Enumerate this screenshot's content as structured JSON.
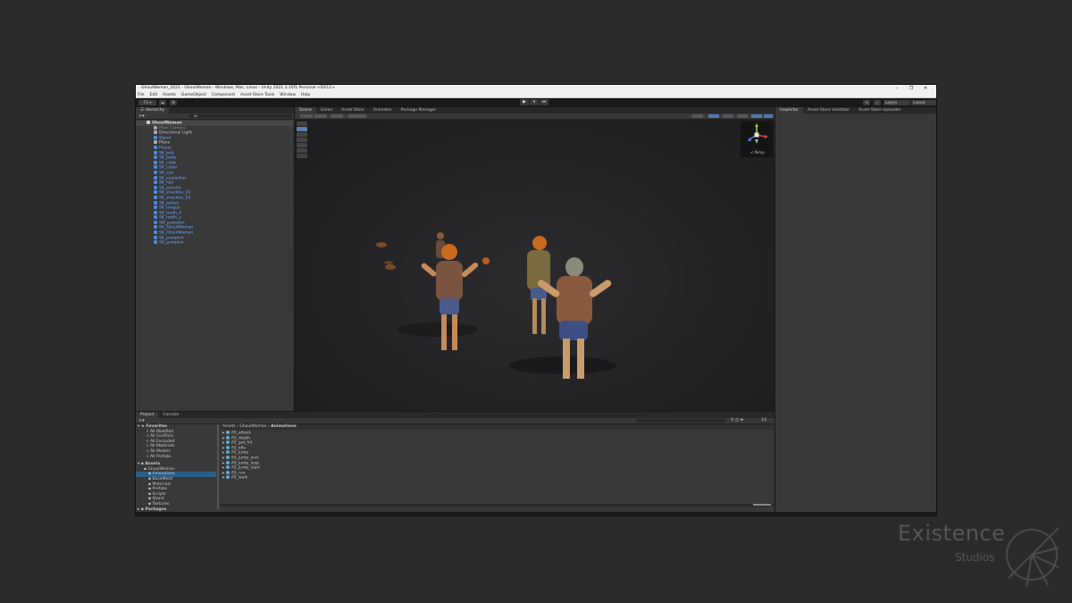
{
  "window": {
    "title": "GhoulWoman_2021 - GhoulWoman - Windows, Mac, Linux - Unity 2021.3.35f1 Personal <DX11>",
    "controls": [
      "–",
      "❐",
      "✕"
    ]
  },
  "menu": [
    "File",
    "Edit",
    "Assets",
    "GameObject",
    "Component",
    "Asset Store Tools",
    "Window",
    "Help"
  ],
  "toolbar": {
    "account": "TG ▾",
    "layers": "Layers",
    "layout": "Layout",
    "play": "▶",
    "pause": "⏸",
    "step": "⏭"
  },
  "hierarchy": {
    "tab": "Hierarchy",
    "search_placeholder": "All",
    "root": "GhoulWoman",
    "items": [
      {
        "label": "Main Camera",
        "style": "grey"
      },
      {
        "label": "Directional Light",
        "style": "normal"
      },
      {
        "label": "Stand",
        "style": "blue"
      },
      {
        "label": "Plane",
        "style": "normal"
      },
      {
        "label": "Player",
        "style": "blue"
      },
      {
        "label": "SK_belt",
        "style": "blue"
      },
      {
        "label": "SK_body",
        "style": "blue"
      },
      {
        "label": "SK_cloth",
        "style": "blue"
      },
      {
        "label": "SK_collar",
        "style": "blue"
      },
      {
        "label": "SK_eye",
        "style": "blue"
      },
      {
        "label": "SK_eyelashes",
        "style": "blue"
      },
      {
        "label": "SK_hair",
        "style": "blue"
      },
      {
        "label": "SK_poncho",
        "style": "blue"
      },
      {
        "label": "SK_shackles_01",
        "style": "blue"
      },
      {
        "label": "SK_shackles_02",
        "style": "blue"
      },
      {
        "label": "SK_spikes",
        "style": "blue"
      },
      {
        "label": "SK_tongue",
        "style": "blue"
      },
      {
        "label": "SK_tooth_d",
        "style": "blue"
      },
      {
        "label": "SK_tooth_u",
        "style": "blue"
      },
      {
        "label": "SM_pumpkin",
        "style": "blue"
      },
      {
        "label": "SK_GhoulWoman",
        "style": "blue"
      },
      {
        "label": "SK_GhoulWoman",
        "style": "blue"
      },
      {
        "label": "SK_pumpkin",
        "style": "blue"
      },
      {
        "label": "SK_pumpkin",
        "style": "blue"
      }
    ]
  },
  "scene": {
    "tabs": [
      "Scene",
      "Game",
      "Asset Store",
      "Animator",
      "Package Manager"
    ],
    "gizmo_label": "< Persp"
  },
  "inspector": {
    "tabs": [
      "Inspector",
      "Asset Store Validator",
      "Asset Store Uploader"
    ]
  },
  "project": {
    "tabs": [
      "Project",
      "Console"
    ],
    "favorites_label": "Favorites",
    "favorites": [
      "All Modified",
      "All Conflicts",
      "All Excluded",
      "All Materials",
      "All Models",
      "All Prefabs"
    ],
    "assets_label": "Assets",
    "tree": [
      {
        "label": "GhoulWoman",
        "indent": 1
      },
      {
        "label": "Animations",
        "indent": 2,
        "selected": true
      },
      {
        "label": "BaseMesh",
        "indent": 2
      },
      {
        "label": "Materials",
        "indent": 2
      },
      {
        "label": "Prefabs",
        "indent": 2
      },
      {
        "label": "Scripts",
        "indent": 2
      },
      {
        "label": "Stand",
        "indent": 2
      },
      {
        "label": "Textures",
        "indent": 2
      }
    ],
    "packages_label": "Packages",
    "breadcrumb": [
      "Assets",
      "GhoulWoman",
      "Animations"
    ],
    "files": [
      "AS_attack",
      "AS_death",
      "AS_get_hit",
      "AS_idle",
      "AS_jump",
      "AS_jump_end",
      "AS_jump_loop",
      "AS_jump_start",
      "AS_run",
      "AS_walk"
    ],
    "count": "13"
  },
  "watermark": {
    "title": "Existence",
    "subtitle": "Studios"
  }
}
